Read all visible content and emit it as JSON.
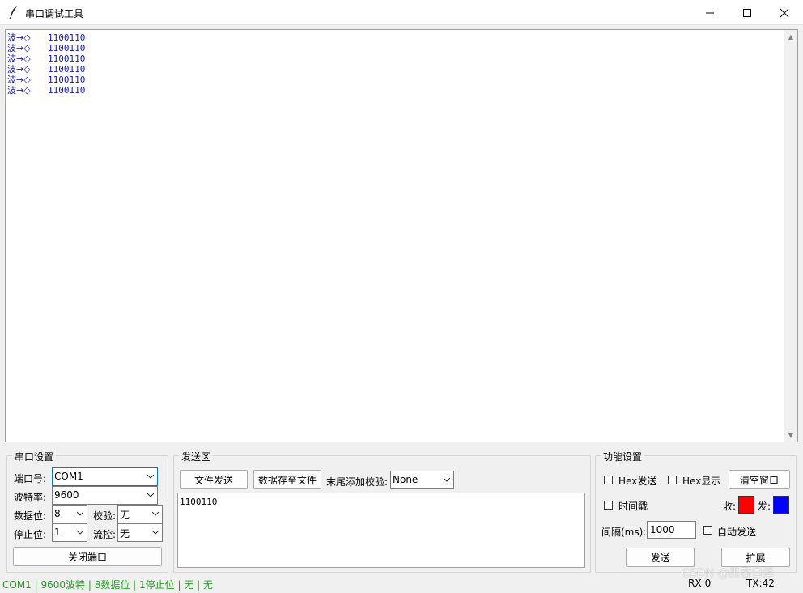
{
  "window": {
    "title": "串口调试工具",
    "controls": [
      "minimize",
      "maximize",
      "close"
    ]
  },
  "receive": {
    "lines": [
      {
        "prefix": "波→◇",
        "value": "1100110"
      },
      {
        "prefix": "波→◇",
        "value": "1100110"
      },
      {
        "prefix": "波→◇",
        "value": "1100110"
      },
      {
        "prefix": "波→◇",
        "value": "1100110"
      },
      {
        "prefix": "波→◇",
        "value": "1100110"
      },
      {
        "prefix": "波→◇",
        "value": "1100110"
      }
    ]
  },
  "port_settings": {
    "title": "串口设置",
    "port_label": "端口号:",
    "port_value": "COM1",
    "baud_label": "波特率:",
    "baud_value": "9600",
    "databits_label": "数据位:",
    "databits_value": "8",
    "parity_label": "校验:",
    "parity_value": "无",
    "stopbits_label": "停止位:",
    "stopbits_value": "1",
    "flow_label": "流控:",
    "flow_value": "无",
    "close_button": "关闭端口"
  },
  "send_area": {
    "title": "发送区",
    "file_send_button": "文件发送",
    "save_button": "数据存至文件",
    "checksum_label": "末尾添加校验:",
    "checksum_value": "None",
    "text": "1100110"
  },
  "func_settings": {
    "title": "功能设置",
    "hex_send_label": "Hex发送",
    "hex_send_checked": false,
    "hex_display_label": "Hex显示",
    "hex_display_checked": false,
    "clear_button": "清空窗口",
    "timestamp_label": "时间戳",
    "timestamp_checked": false,
    "recv_color_label": "收:",
    "recv_color": "#ff0000",
    "send_color_label": "发:",
    "send_color": "#0000ff",
    "interval_label": "间隔(ms):",
    "interval_value": "1000",
    "auto_send_label": "自动发送",
    "auto_send_checked": false,
    "send_button": "发送",
    "expand_button": "扩展"
  },
  "status": {
    "left": "COM1 | 9600波特 | 8数据位 | 1停止位 | 无 | 无",
    "rx": "RX:0",
    "tx": "TX:42",
    "watermark": "CSDN @黑客白泽"
  }
}
